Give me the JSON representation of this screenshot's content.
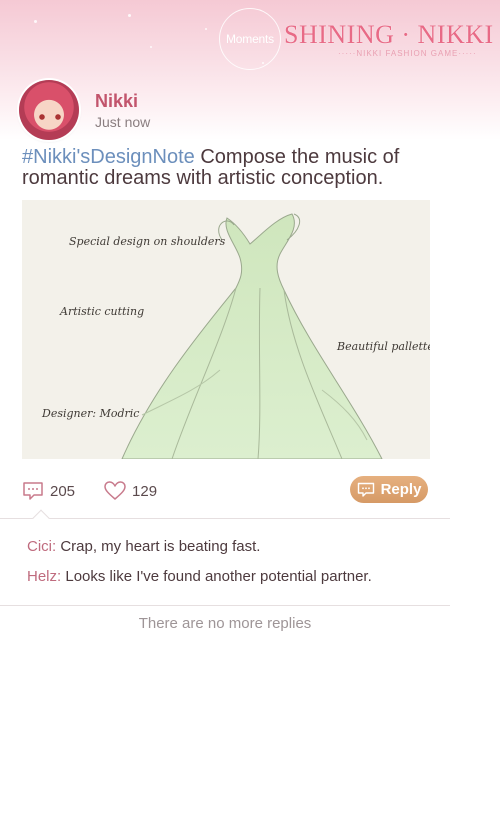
{
  "header": {
    "moments_label": "Moments",
    "logo_title": "SHINING · NIKKI",
    "logo_subtitle": "·····NIKKI FASHION GAME·····"
  },
  "post": {
    "author": "Nikki",
    "time": "Just now",
    "hashtag": "#Nikki'sDesignNote",
    "body": " Compose the music of romantic dreams with artistic conception.",
    "image": {
      "note_shoulders": "Special design on shoulders",
      "note_cutting": "Artistic cutting",
      "note_palette": "Beautiful pallette",
      "note_designer": "Designer: Modric"
    },
    "comment_count": "205",
    "like_count": "129",
    "reply_label": "Reply"
  },
  "comments": [
    {
      "author": "Cici",
      "sep": ":",
      "text": " Crap, my heart is beating fast."
    },
    {
      "author": "Helz",
      "sep": ":",
      "text": " Looks like I've found another potential partner."
    }
  ],
  "end_note": "There are no more replies",
  "colors": {
    "accent": "#e86a86",
    "hashtag": "#6c8fbc",
    "reply_button": "#d9a06c",
    "name": "#c2546c"
  }
}
